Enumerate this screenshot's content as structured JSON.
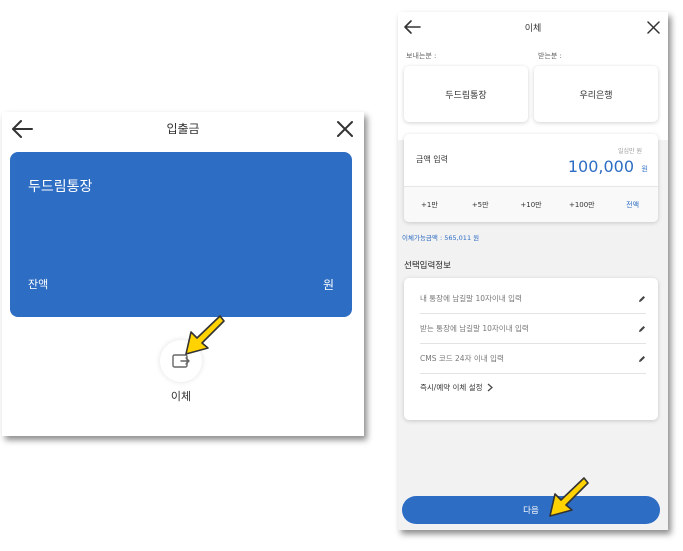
{
  "left_screen": {
    "title": "입출금",
    "card": {
      "account_name": "두드림통장",
      "balance_label": "잔액",
      "balance_unit": "원",
      "color": "#2d6dc4"
    },
    "transfer_label": "이체",
    "icons": [
      "back-arrow-icon",
      "close-icon",
      "transfer-icon"
    ]
  },
  "right_screen": {
    "title": "이체",
    "from_label": "보내는분 :",
    "to_label": "받는분 :",
    "from_account": "두드림통장",
    "to_bank": "우리은행",
    "amount": {
      "label": "금액 입력",
      "sub_label": "일십만 원",
      "value": "100,000",
      "unit": "원"
    },
    "quick_buttons": [
      "+1만",
      "+5만",
      "+10만",
      "+100만",
      "전액"
    ],
    "available_text": "이체가능금액 : 565,011 원",
    "section_title": "선택입력정보",
    "info_rows": [
      "내 통장에 남길말 10자이내 입력",
      "받는 통장에 남길말 10자이내 입력",
      "CMS 코드 24자 이내 입력"
    ],
    "schedule_option": "즉시/예약 이체 설정",
    "next_button": "다음",
    "accent_color": "#2d6dc4"
  },
  "pointer_color": "#ffd200"
}
